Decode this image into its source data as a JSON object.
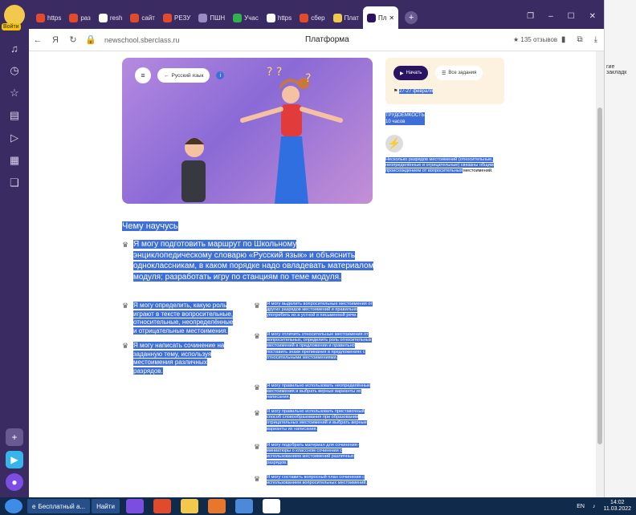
{
  "sidebar": {
    "profile_label": "Войти"
  },
  "tabs": [
    {
      "label": "https",
      "color": "#e24a2c"
    },
    {
      "label": "раз",
      "color": "#e24a2c"
    },
    {
      "label": "resh",
      "color": "#ffffff"
    },
    {
      "label": "сайт",
      "color": "#e24a2c"
    },
    {
      "label": "РЕЗУ",
      "color": "#e24a2c"
    },
    {
      "label": "ПШН",
      "color": "#9b8bc4"
    },
    {
      "label": "Учас",
      "color": "#2fb34a"
    },
    {
      "label": "https",
      "color": "#ffffff"
    },
    {
      "label": "сбер",
      "color": "#e24a2c"
    },
    {
      "label": "Плат",
      "color": "#f2c94c"
    }
  ],
  "active_tab": {
    "label": "Пл"
  },
  "address": {
    "url": "newschool.sberclass.ru",
    "page_title": "Платформа",
    "reviews": "★ 135 отзывов"
  },
  "hero": {
    "back_label": "Русский язык"
  },
  "sidecard": {
    "start": "Начать",
    "tasks": "Все задания",
    "dates": "27-27 февраля"
  },
  "meta": {
    "label": "ТРУДОЕМКОСТЬ",
    "value": "10 часов"
  },
  "description": {
    "selected": "Несколько разрядов местоимений (относительные, неопределённые и отрицательные) связаны общим происхождением от вопросительных",
    "rest": " местоимений."
  },
  "learn": {
    "heading": "Чему научусь",
    "main_goal": "Я могу подготовить маршрут по Школьному энциклопедическому словарю «Русский язык» и объяснить одноклассникам, в каком порядке надо овладевать материалом модуля; разработать игру по станциям по теме модуля.",
    "left_goals": [
      "Я могу определить, какую роль играют в тексте вопросительные, относительные, неопределённые и отрицательные местоимения.",
      "Я могу написать сочинение на заданную тему, используя местоимения различных разрядов."
    ],
    "right_goals": [
      "Я могу выделить вопросительные местоимения от других разрядов местоимений и правильно употребить их в устной и письменной речи.",
      "Я могу отличить относительные местоимения от вопросительных, определить роль относительных местоимений в предложении и правильно поставить знаки препинания в предложениях с относительными местоимениями.",
      "Я могу правильно использовать неопределённые местоимения и выбрать верные варианты их написания.",
      "Я могу правильно использовать приставочный способ словообразования при образовании отрицательных местоимений и выбрать верные варианты их написания.",
      "Я могу подобрать материал для сочинения-миниатюры о классном сочинении с использованием местоимений различных разрядов.",
      "Я могу составить вопросный план сочинения с использованием вопросительных местоимений."
    ]
  },
  "right_pane": {
    "text": "гие закладк"
  },
  "taskbar": {
    "browser_item": "Бесплатный а...",
    "search": "Найти",
    "lang": "EN",
    "time": "14:02",
    "date": "11.03.2022"
  }
}
